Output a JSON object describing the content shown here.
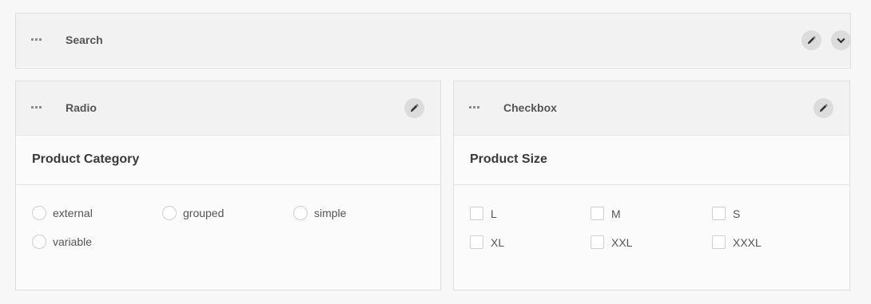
{
  "search_panel": {
    "title": "Search"
  },
  "radio_panel": {
    "title": "Radio",
    "section_title": "Product Category",
    "options": [
      "external",
      "grouped",
      "simple",
      "variable"
    ]
  },
  "checkbox_panel": {
    "title": "Checkbox",
    "section_title": "Product Size",
    "options": [
      "L",
      "M",
      "S",
      "XL",
      "XXL",
      "XXXL"
    ]
  },
  "icons": {
    "drag": "drag-handle-icon",
    "edit": "pencil-icon",
    "expand": "chevron-down-icon"
  },
  "colors": {
    "background": "#f7f7f7",
    "header": "#f2f2f2",
    "button": "#dcdcdc"
  }
}
